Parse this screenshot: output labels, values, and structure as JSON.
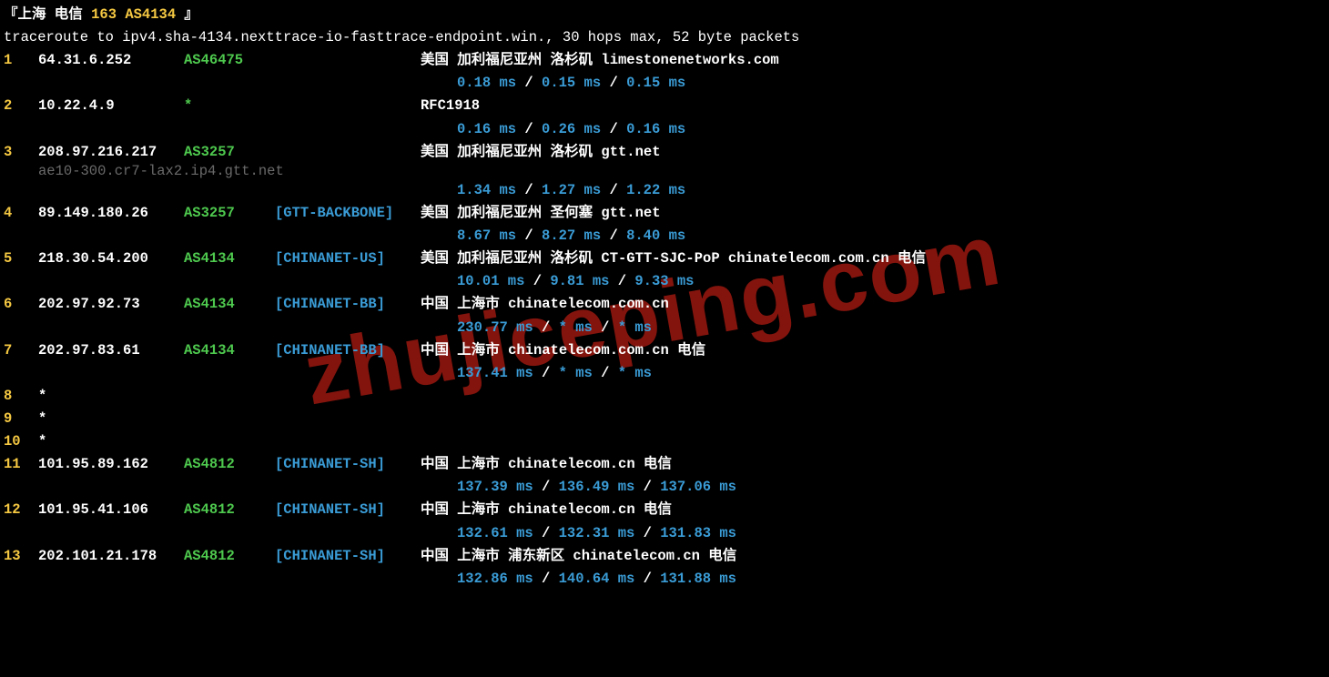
{
  "header": {
    "prefix": "『上海 电信 ",
    "asn": "163 AS4134",
    "suffix": " 』"
  },
  "cmd": "traceroute to ipv4.sha-4134.nexttrace-io-fasttrace-endpoint.win., 30 hops max, 52 byte packets",
  "watermark": "zhujiceping.com",
  "hops": [
    {
      "n": "1",
      "ip": "64.31.6.252",
      "asn": "AS46475",
      "tag": "",
      "loc": "美国 加利福尼亚州 洛杉矶  limestonenetworks.com",
      "t1": "0.18 ms",
      "t2": "0.15 ms",
      "t3": "0.15 ms"
    },
    {
      "n": "2",
      "ip": "10.22.4.9",
      "asn": "*",
      "tag": "",
      "loc": "RFC1918",
      "t1": "0.16 ms",
      "t2": "0.26 ms",
      "t3": "0.16 ms"
    },
    {
      "n": "3",
      "ip": "208.97.216.217",
      "asn": "AS3257",
      "tag": "",
      "loc": "美国 加利福尼亚州 洛杉矶  gtt.net",
      "rdns": "ae10-300.cr7-lax2.ip4.gtt.net",
      "t1": "1.34 ms",
      "t2": "1.27 ms",
      "t3": "1.22 ms"
    },
    {
      "n": "4",
      "ip": "89.149.180.26",
      "asn": "AS3257",
      "tag": "[GTT-BACKBONE]",
      "loc": "美国 加利福尼亚州 圣何塞  gtt.net",
      "t1": "8.67 ms",
      "t2": "8.27 ms",
      "t3": "8.40 ms"
    },
    {
      "n": "5",
      "ip": "218.30.54.200",
      "asn": "AS4134",
      "tag": "[CHINANET-US]",
      "loc": "美国 加利福尼亚州 洛杉矶 CT-GTT-SJC-PoP chinatelecom.com.cn  电信",
      "t1": "10.01 ms",
      "t2": "9.81 ms",
      "t3": "9.33 ms"
    },
    {
      "n": "6",
      "ip": "202.97.92.73",
      "asn": "AS4134",
      "tag": "[CHINANET-BB]",
      "loc": "中国 上海市   chinatelecom.com.cn",
      "t1": "230.77 ms",
      "t2": "* ms",
      "t3": "* ms"
    },
    {
      "n": "7",
      "ip": "202.97.83.61",
      "asn": "AS4134",
      "tag": "[CHINANET-BB]",
      "loc": "中国 上海市   chinatelecom.com.cn  电信",
      "t1": "137.41 ms",
      "t2": "* ms",
      "t3": "* ms"
    },
    {
      "n": "8",
      "ip": "*",
      "star": true
    },
    {
      "n": "9",
      "ip": "*",
      "star": true
    },
    {
      "n": "10",
      "ip": "*",
      "star": true
    },
    {
      "n": "11",
      "ip": "101.95.89.162",
      "asn": "AS4812",
      "tag": "[CHINANET-SH]",
      "loc": "中国 上海市   chinatelecom.cn  电信",
      "t1": "137.39 ms",
      "t2": "136.49 ms",
      "t3": "137.06 ms"
    },
    {
      "n": "12",
      "ip": "101.95.41.106",
      "asn": "AS4812",
      "tag": "[CHINANET-SH]",
      "loc": "中国 上海市   chinatelecom.cn  电信",
      "t1": "132.61 ms",
      "t2": "132.31 ms",
      "t3": "131.83 ms"
    },
    {
      "n": "13",
      "ip": "202.101.21.178",
      "asn": "AS4812",
      "tag": "[CHINANET-SH]",
      "loc": "中国 上海市  浦东新区 chinatelecom.cn  电信",
      "t1": "132.86 ms",
      "t2": "140.64 ms",
      "t3": "131.88 ms"
    }
  ],
  "sep": " / "
}
